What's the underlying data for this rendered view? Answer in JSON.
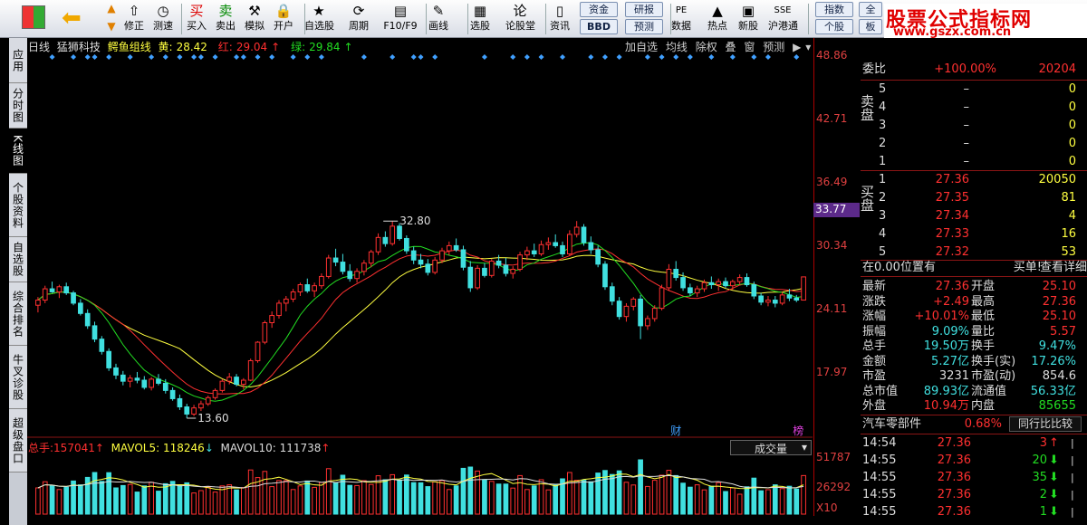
{
  "toolbar": {
    "items": [
      {
        "label": "修正",
        "icon": "up-arrow-icon"
      },
      {
        "label": "测速",
        "icon": "clock-icon"
      },
      {
        "label": "买入",
        "icon": "buy-icon"
      },
      {
        "label": "卖出",
        "icon": "sell-icon"
      },
      {
        "label": "模拟",
        "icon": "hammer-icon"
      },
      {
        "label": "开户",
        "icon": "lock-icon"
      },
      {
        "label": "自选股",
        "icon": "star-icon"
      },
      {
        "label": "周期",
        "icon": "cycle-icon"
      },
      {
        "label": "F10/F9",
        "icon": "f10-icon"
      },
      {
        "label": "画线",
        "icon": "pen-icon"
      },
      {
        "label": "选股",
        "icon": "screen-icon"
      },
      {
        "label": "论股堂",
        "icon": "forum-icon"
      },
      {
        "label": "资讯",
        "icon": "news-icon"
      },
      {
        "label": "数据",
        "icon": "pe-icon"
      },
      {
        "label": "热点",
        "icon": "hot-icon"
      },
      {
        "label": "新股",
        "icon": "newstock-icon"
      },
      {
        "label": "沪港通",
        "icon": "sse-hke-icon"
      }
    ],
    "mini": {
      "zijin": "资金",
      "bbd": "BBD",
      "yanbao": "研报",
      "yuce": "预测",
      "zhishu": "指数",
      "gegu": "个股",
      "quan": "全",
      "ban": "板"
    },
    "icon_glyphs": {
      "修正": "⇧",
      "测速": "◷",
      "买入": "买",
      "卖出": "卖",
      "模拟": "⚒",
      "开户": "🔒",
      "自选股": "★",
      "周期": "⟳",
      "F10/F9": "▤",
      "画线": "✎",
      "选股": "▦",
      "论股堂": "论",
      "资讯": "▯",
      "数据": "PE",
      "热点": "▲",
      "新股": "▣",
      "沪港通": "SSE"
    }
  },
  "logo": {
    "line1": "股票公式指标网",
    "line2": "www.gszx.com.cn"
  },
  "sidebar": {
    "tabs": [
      "应用",
      "分时图",
      "K线图",
      "个股资料",
      "自选股",
      "综合排名",
      "牛叉诊股",
      "超级盘口"
    ]
  },
  "chart": {
    "period": "日线",
    "stock": "猛狮科技",
    "indicator": "鳄鱼组线",
    "legend": [
      {
        "name": "黄:",
        "value": "28.42",
        "arrow": "↑"
      },
      {
        "name": "红:",
        "value": "29.04",
        "arrow": "↑"
      },
      {
        "name": "绿:",
        "value": "29.84",
        "arrow": "↑"
      }
    ],
    "controls": [
      "加自选",
      "均线",
      "除权",
      "叠",
      "窗",
      "预测"
    ],
    "y_ticks": [
      "48.86",
      "42.71",
      "36.49",
      "30.34",
      "24.11",
      "17.97"
    ],
    "current_price": "33.77",
    "high_label": "32.80",
    "low_label": "13.60",
    "markers": [
      "财",
      "榜"
    ],
    "volume": {
      "total_label": "总手:",
      "total": "157041",
      "total_arrow": "↑",
      "mavol5_label": "MAVOL5:",
      "mavol5": "118246",
      "mavol5_arrow": "↓",
      "mavol10_label": "MAVOL10:",
      "mavol10": "111738",
      "mavol10_arrow": "↑",
      "selector": "成交量",
      "y_ticks": [
        "51787",
        "26292"
      ],
      "unit": "X10"
    },
    "colors": {
      "up": "#ff3030",
      "down": "#40e0e0",
      "yellow": "#ffff40",
      "red": "#ff3030",
      "green": "#22dd22",
      "diamond": "#40a0ff"
    }
  },
  "chart_data": {
    "type": "candlestick",
    "ylim": [
      13.6,
      48.86
    ],
    "ohlc": [
      [
        24.6,
        25.4,
        23.9,
        25.1
      ],
      [
        25.1,
        26.5,
        24.8,
        26.2
      ],
      [
        26.2,
        26.9,
        25.8,
        25.9
      ],
      [
        25.9,
        26.6,
        25.3,
        26.4
      ],
      [
        26.4,
        26.8,
        25.6,
        25.8
      ],
      [
        25.8,
        26.0,
        24.6,
        24.8
      ],
      [
        24.8,
        25.2,
        23.6,
        23.8
      ],
      [
        23.8,
        24.2,
        22.3,
        22.6
      ],
      [
        22.6,
        23.0,
        21.0,
        21.3
      ],
      [
        21.3,
        21.6,
        19.8,
        20.1
      ],
      [
        20.1,
        20.4,
        18.2,
        18.5
      ],
      [
        18.5,
        18.9,
        17.4,
        17.8
      ],
      [
        17.8,
        18.2,
        16.8,
        17.2
      ],
      [
        17.2,
        17.8,
        16.6,
        17.5
      ],
      [
        17.5,
        18.1,
        17.0,
        17.3
      ],
      [
        17.3,
        17.7,
        16.4,
        16.6
      ],
      [
        16.6,
        17.6,
        16.3,
        17.4
      ],
      [
        17.4,
        17.9,
        16.8,
        17.0
      ],
      [
        17.0,
        17.4,
        16.0,
        16.3
      ],
      [
        16.3,
        16.6,
        15.3,
        15.5
      ],
      [
        15.5,
        15.9,
        14.4,
        14.7
      ],
      [
        14.7,
        15.0,
        13.6,
        14.0
      ],
      [
        14.0,
        14.9,
        13.8,
        14.6
      ],
      [
        14.6,
        15.3,
        14.3,
        15.0
      ],
      [
        15.0,
        15.8,
        14.8,
        15.6
      ],
      [
        15.6,
        16.5,
        15.4,
        16.3
      ],
      [
        16.3,
        17.4,
        16.1,
        17.2
      ],
      [
        17.2,
        18.0,
        16.9,
        17.6
      ],
      [
        17.6,
        17.9,
        16.7,
        16.9
      ],
      [
        16.9,
        17.5,
        16.4,
        17.3
      ],
      [
        17.3,
        19.4,
        17.2,
        19.2
      ],
      [
        19.2,
        21.1,
        19.0,
        21.0
      ],
      [
        21.0,
        23.1,
        20.8,
        22.9
      ],
      [
        22.9,
        24.0,
        22.4,
        23.6
      ],
      [
        23.6,
        25.1,
        23.3,
        24.8
      ],
      [
        24.8,
        25.5,
        24.0,
        25.2
      ],
      [
        25.2,
        26.2,
        24.9,
        25.9
      ],
      [
        25.9,
        26.8,
        25.5,
        26.6
      ],
      [
        26.6,
        27.2,
        25.8,
        26.0
      ],
      [
        26.0,
        26.8,
        25.4,
        26.5
      ],
      [
        26.5,
        27.7,
        26.2,
        27.4
      ],
      [
        27.4,
        29.5,
        27.2,
        29.2
      ],
      [
        29.2,
        30.1,
        28.4,
        28.8
      ],
      [
        28.8,
        29.6,
        27.6,
        27.9
      ],
      [
        27.9,
        28.6,
        26.9,
        27.2
      ],
      [
        27.2,
        28.2,
        26.8,
        27.9
      ],
      [
        27.9,
        29.0,
        27.5,
        28.7
      ],
      [
        28.7,
        30.0,
        28.3,
        29.8
      ],
      [
        29.8,
        31.6,
        29.5,
        31.2
      ],
      [
        31.2,
        31.8,
        30.3,
        30.6
      ],
      [
        30.6,
        32.8,
        30.4,
        32.3
      ],
      [
        32.3,
        32.6,
        30.9,
        31.1
      ],
      [
        31.1,
        31.4,
        29.6,
        29.9
      ],
      [
        29.9,
        30.3,
        28.6,
        29.0
      ],
      [
        29.0,
        29.6,
        28.2,
        28.6
      ],
      [
        28.6,
        29.1,
        27.5,
        27.8
      ],
      [
        27.8,
        29.3,
        27.6,
        29.0
      ],
      [
        29.0,
        30.2,
        28.7,
        29.9
      ],
      [
        29.9,
        30.8,
        29.5,
        30.4
      ],
      [
        30.4,
        31.1,
        29.8,
        30.0
      ],
      [
        30.0,
        30.4,
        28.0,
        28.3
      ],
      [
        28.3,
        28.9,
        25.9,
        26.3
      ],
      [
        26.3,
        28.5,
        26.1,
        28.2
      ],
      [
        28.2,
        28.7,
        27.3,
        27.5
      ],
      [
        27.5,
        29.1,
        27.3,
        28.9
      ],
      [
        28.9,
        29.5,
        28.2,
        28.5
      ],
      [
        28.5,
        29.2,
        27.4,
        27.7
      ],
      [
        27.7,
        28.4,
        27.2,
        28.1
      ],
      [
        28.1,
        29.8,
        27.9,
        29.5
      ],
      [
        29.5,
        30.3,
        29.0,
        29.9
      ],
      [
        29.9,
        30.6,
        29.3,
        29.6
      ],
      [
        29.6,
        30.9,
        29.4,
        30.5
      ],
      [
        30.5,
        31.2,
        30.0,
        30.7
      ],
      [
        30.7,
        31.5,
        30.2,
        30.4
      ],
      [
        30.4,
        30.8,
        29.3,
        29.6
      ],
      [
        29.6,
        31.9,
        29.4,
        31.5
      ],
      [
        31.5,
        32.8,
        31.2,
        32.2
      ],
      [
        32.2,
        32.5,
        30.4,
        30.7
      ],
      [
        30.7,
        31.3,
        29.6,
        30.0
      ],
      [
        30.0,
        30.4,
        28.3,
        28.6
      ],
      [
        28.6,
        28.9,
        26.1,
        26.4
      ],
      [
        26.4,
        26.8,
        24.6,
        25.0
      ],
      [
        25.0,
        25.4,
        23.2,
        23.5
      ],
      [
        23.5,
        24.8,
        23.0,
        24.5
      ],
      [
        24.5,
        25.4,
        24.1,
        25.2
      ],
      [
        25.2,
        25.6,
        21.3,
        22.6
      ],
      [
        22.6,
        23.6,
        22.2,
        23.3
      ],
      [
        23.3,
        24.6,
        23.0,
        24.3
      ],
      [
        24.3,
        26.6,
        24.1,
        26.3
      ],
      [
        26.3,
        28.6,
        26.0,
        28.1
      ],
      [
        28.1,
        28.9,
        27.0,
        27.3
      ],
      [
        27.3,
        27.8,
        26.0,
        26.3
      ],
      [
        26.3,
        26.7,
        25.5,
        25.8
      ],
      [
        25.8,
        26.5,
        25.4,
        26.2
      ],
      [
        26.2,
        27.1,
        25.9,
        26.8
      ],
      [
        26.8,
        27.4,
        26.2,
        26.6
      ],
      [
        26.6,
        27.2,
        26.0,
        26.9
      ],
      [
        26.9,
        27.3,
        26.3,
        26.5
      ],
      [
        26.5,
        27.1,
        26.1,
        26.9
      ],
      [
        26.9,
        27.6,
        26.6,
        27.3
      ],
      [
        27.3,
        27.7,
        26.4,
        26.6
      ],
      [
        26.6,
        26.9,
        25.2,
        25.5
      ],
      [
        25.5,
        25.8,
        24.6,
        24.9
      ],
      [
        24.9,
        25.5,
        24.5,
        25.1
      ],
      [
        25.1,
        25.5,
        24.4,
        24.8
      ],
      [
        24.8,
        25.9,
        24.6,
        25.6
      ],
      [
        25.6,
        26.2,
        25.0,
        25.3
      ],
      [
        25.3,
        25.6,
        24.9,
        25.1
      ],
      [
        25.1,
        27.36,
        25.1,
        27.36
      ]
    ]
  },
  "panel": {
    "weibi_label": "委比",
    "weibi": "+100.00%",
    "weicha": "20204",
    "sell_label": "卖盘",
    "sells": [
      {
        "lvl": "5",
        "price": "–",
        "vol": "0"
      },
      {
        "lvl": "4",
        "price": "–",
        "vol": "0"
      },
      {
        "lvl": "3",
        "price": "–",
        "vol": "0"
      },
      {
        "lvl": "2",
        "price": "–",
        "vol": "0"
      },
      {
        "lvl": "1",
        "price": "–",
        "vol": "0"
      }
    ],
    "buy_label": "买盘",
    "buys": [
      {
        "lvl": "1",
        "price": "27.36",
        "vol": "20050"
      },
      {
        "lvl": "2",
        "price": "27.35",
        "vol": "81"
      },
      {
        "lvl": "3",
        "price": "27.34",
        "vol": "4"
      },
      {
        "lvl": "4",
        "price": "27.33",
        "vol": "16"
      },
      {
        "lvl": "5",
        "price": "27.32",
        "vol": "53"
      }
    ],
    "position_label": "在0.00位置有",
    "buy_single": "买单!",
    "detail_link": "查看详细",
    "stats": [
      [
        "最新",
        "27.36",
        "开盘",
        "25.10"
      ],
      [
        "涨跌",
        "+2.49",
        "最高",
        "27.36"
      ],
      [
        "涨幅",
        "+10.01%",
        "最低",
        "25.10"
      ],
      [
        "振幅",
        "9.09%",
        "量比",
        "5.57"
      ],
      [
        "总手",
        "19.50万",
        "换手",
        "9.47%"
      ],
      [
        "金额",
        "5.27亿",
        "换手(实)",
        "17.26%"
      ],
      [
        "市盈",
        "3231",
        "市盈(动)",
        "854.6"
      ],
      [
        "总市值",
        "89.93亿",
        "流通值",
        "56.33亿"
      ],
      [
        "外盘",
        "10.94万",
        "内盘",
        "85655"
      ]
    ],
    "sector_name": "汽车零部件",
    "sector_change": "0.68%",
    "compare_btn": "同行比比较",
    "ticks": [
      {
        "time": "14:54",
        "price": "27.36",
        "vol": "3",
        "dir": "up"
      },
      {
        "time": "14:55",
        "price": "27.36",
        "vol": "20",
        "dir": "down"
      },
      {
        "time": "14:55",
        "price": "27.36",
        "vol": "35",
        "dir": "down"
      },
      {
        "time": "14:55",
        "price": "27.36",
        "vol": "2",
        "dir": "down"
      },
      {
        "time": "14:55",
        "price": "27.36",
        "vol": "1",
        "dir": "down"
      }
    ]
  }
}
